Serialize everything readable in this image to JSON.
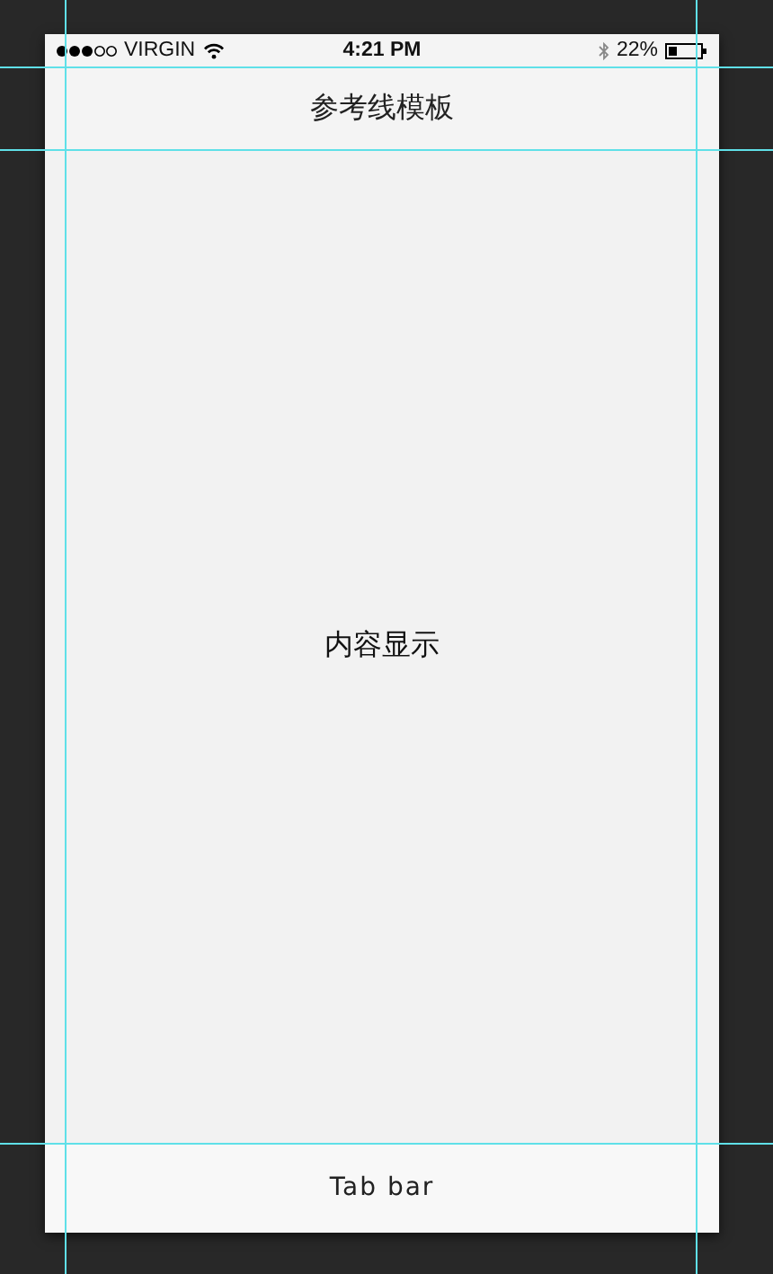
{
  "status_bar": {
    "carrier": "VIRGIN",
    "time": "4:21 PM",
    "battery": "22%"
  },
  "nav_bar": {
    "title": "参考线模板"
  },
  "content": {
    "text": "内容显示"
  },
  "tab_bar": {
    "label": "Tab bar"
  }
}
